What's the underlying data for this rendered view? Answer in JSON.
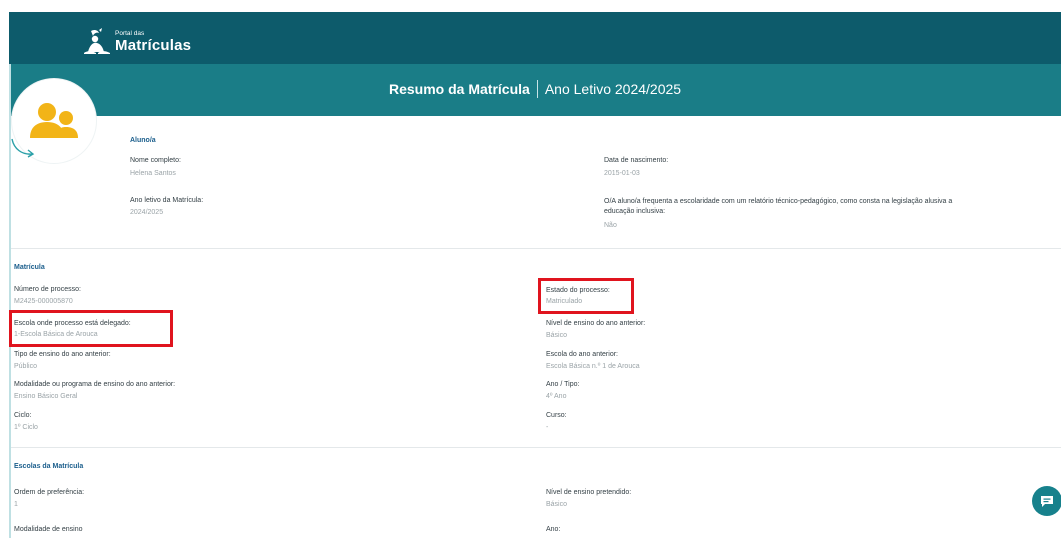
{
  "app": {
    "logo_small": "Portal das",
    "logo_big": "Matrículas"
  },
  "header": {
    "title": "Resumo da Matrícula",
    "school_year": "Ano Letivo 2024/2025"
  },
  "student": {
    "section_title": "Aluno/a",
    "full_name_label": "Nome completo:",
    "full_name_value": "Helena Santos",
    "birth_date_label": "Data de nascimento:",
    "birth_date_value": "2015-01-03",
    "school_year_label": "Ano letivo da Matrícula:",
    "school_year_value": "2024/2025",
    "inclusive_label": "O/A aluno/a frequenta a escolaridade com um relatório técnico-pedagógico, como consta na legislação alusiva a educação inclusiva:",
    "inclusive_value": "Não"
  },
  "enrollment": {
    "section_title": "Matrícula",
    "process_number_label": "Número de processo:",
    "process_number_value": "M2425-000005870",
    "process_state_label": "Estado do processo:",
    "process_state_value": "Matriculado",
    "delegated_school_label": "Escola onde processo está delegado:",
    "delegated_school_value": "1-Escola Básica de Arouca",
    "prev_level_label": "Nível de ensino do ano anterior:",
    "prev_level_value": "Básico",
    "prev_type_label": "Tipo de ensino do ano anterior:",
    "prev_type_value": "Público",
    "prev_school_label": "Escola do ano anterior:",
    "prev_school_value": "Escola Básica n.º 1 de Arouca",
    "prev_modality_label": "Modalidade ou programa de ensino do ano anterior:",
    "prev_modality_value": "Ensino Básico Geral",
    "year_type_label": "Ano / Tipo:",
    "year_type_value": "4º Ano",
    "cycle_label": "Ciclo:",
    "cycle_value": "1º Ciclo",
    "course_label": "Curso:",
    "course_value": "-"
  },
  "schools": {
    "section_title": "Escolas da Matrícula",
    "preference_label": "Ordem de preferência:",
    "preference_value": "1",
    "intended_level_label": "Nível de ensino pretendido:",
    "intended_level_value": "Básico",
    "modality_label": "Modalidade de ensino",
    "year_label": "Ano:"
  },
  "colors": {
    "topbar": "#0d5b6b",
    "band": "#1a7d87",
    "avatar_icon": "#f2b417",
    "highlight": "#e0141e",
    "section_title": "#1b5e8c"
  },
  "icons": {
    "logo": "portal-logo-icon",
    "avatar": "people-avatar-icon",
    "arrow": "curved-arrow-icon",
    "chat": "chat-bubble-icon"
  }
}
